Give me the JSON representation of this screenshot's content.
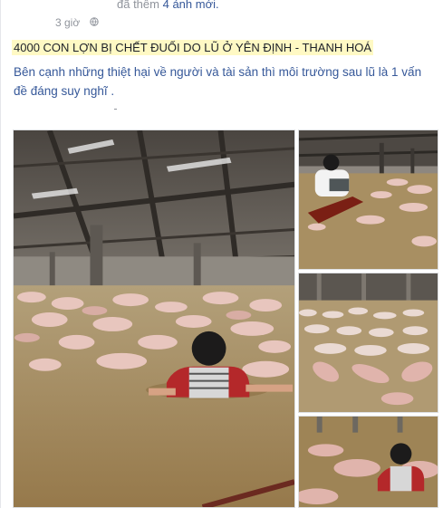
{
  "post": {
    "prev_update_text": "đã thêm",
    "prev_update_link": "4 ảnh mới.",
    "timestamp": "3 giờ",
    "title": "4000 CON LỢN BỊ CHẾT ĐUỐI DO LŨ Ở YÊN ĐỊNH - THANH HOÁ",
    "body": "Bên cạnh những thiệt hại về người và tài sản thì môi trường sau lũ là 1 vấn đề đáng suy nghĩ  ."
  },
  "photos": {
    "count": 4
  },
  "colors": {
    "link": "#365899",
    "meta_gray": "#90949c",
    "flood_water": "#a89062",
    "highlight": "#fff9c4"
  },
  "icons": [
    "globe-icon"
  ]
}
